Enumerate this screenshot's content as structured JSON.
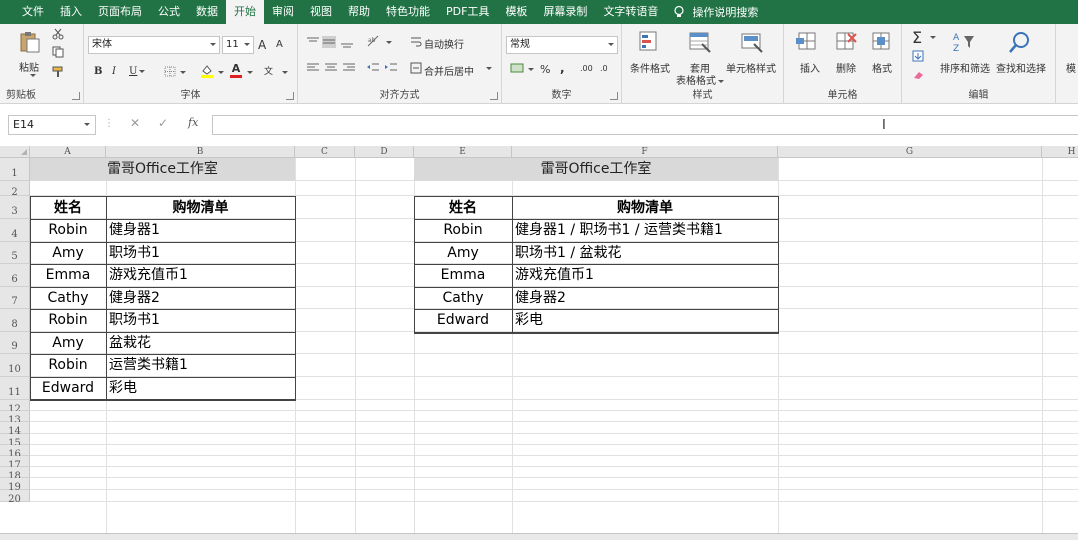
{
  "menu": {
    "tabs": [
      "文件",
      "插入",
      "页面布局",
      "公式",
      "数据",
      "开始",
      "审阅",
      "视图",
      "帮助",
      "特色功能",
      "PDF工具",
      "模板",
      "屏幕录制",
      "文字转语音"
    ],
    "active_tab": "开始",
    "tell_me": "操作说明搜索",
    "accent_color": "#217346"
  },
  "ribbon": {
    "clipboard": {
      "label": "剪贴板",
      "paste": "粘贴"
    },
    "font": {
      "label": "字体",
      "name": "宋体",
      "size": "11",
      "bold": "B",
      "italic": "I",
      "underline": "U",
      "grow": "A",
      "shrink": "A",
      "phonetic": "文"
    },
    "alignment": {
      "label": "对齐方式",
      "wrap": "自动换行",
      "merge": "合并后居中"
    },
    "number": {
      "label": "数字",
      "format": "常规",
      "percent": "%",
      "comma": ",",
      "inc": ".00",
      "dec": ".0"
    },
    "styles": {
      "label": "样式",
      "cond": "条件格式",
      "table": "套用",
      "table2": "表格格式",
      "cell": "单元格样式"
    },
    "cells": {
      "label": "单元格",
      "insert": "插入",
      "delete": "删除",
      "format": "格式"
    },
    "editing": {
      "label": "编辑",
      "sum": "Σ",
      "sort": "排序和筛选",
      "find": "查找和选择"
    },
    "more": "模"
  },
  "formula_bar": {
    "name_box": "E14",
    "cancel": "✕",
    "enter": "✓",
    "fx": "fx",
    "value": ""
  },
  "grid": {
    "columns": [
      "A",
      "B",
      "C",
      "D",
      "E",
      "F",
      "G",
      "H"
    ],
    "rows": [
      "1",
      "2",
      "3",
      "4",
      "5",
      "6",
      "7",
      "8",
      "9",
      "10",
      "11",
      "12",
      "13",
      "14",
      "15",
      "16",
      "17",
      "18",
      "19",
      "20"
    ]
  },
  "left_table": {
    "title": "雷哥Office工作室",
    "headers": [
      "姓名",
      "购物清单"
    ],
    "rows": [
      [
        "Robin",
        "健身器1"
      ],
      [
        "Amy",
        "职场书1"
      ],
      [
        "Emma",
        "游戏充值币1"
      ],
      [
        "Cathy",
        "健身器2"
      ],
      [
        "Robin",
        "职场书1"
      ],
      [
        "Amy",
        "盆栽花"
      ],
      [
        "Robin",
        "运营类书籍1"
      ],
      [
        "Edward",
        "彩电"
      ]
    ]
  },
  "right_table": {
    "title": "雷哥Office工作室",
    "headers": [
      "姓名",
      "购物清单"
    ],
    "rows": [
      [
        "Robin",
        "健身器1 / 职场书1 / 运营类书籍1"
      ],
      [
        "Amy",
        "职场书1 / 盆栽花"
      ],
      [
        "Emma",
        "游戏充值币1"
      ],
      [
        "Cathy",
        "健身器2"
      ],
      [
        "Edward",
        "彩电"
      ]
    ]
  }
}
